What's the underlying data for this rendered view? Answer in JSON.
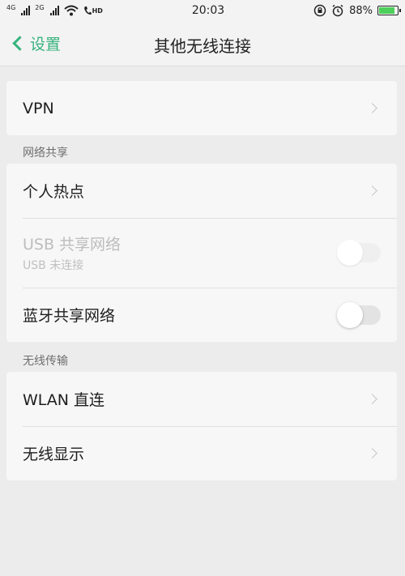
{
  "status_bar": {
    "net_left_1": "4G",
    "net_left_2": "2G",
    "hd": "HD",
    "time": "20:03",
    "battery_percent": "88%",
    "battery_level": 0.88,
    "battery_color": "#4ccf5b"
  },
  "nav": {
    "back_label": "设置",
    "title": "其他无线连接",
    "accent_color": "#36b37e"
  },
  "groups": {
    "vpn": {
      "label": "VPN"
    },
    "sharing": {
      "header": "网络共享",
      "hotspot": "个人热点",
      "usb": {
        "label": "USB 共享网络",
        "sub": "USB 未连接",
        "enabled": false,
        "on": false
      },
      "bluetooth": {
        "label": "蓝牙共享网络",
        "on": false
      }
    },
    "wireless": {
      "header": "无线传输",
      "wlan_direct": "WLAN 直连",
      "wireless_display": "无线显示"
    }
  },
  "icons": [
    "signal-icon",
    "wifi-icon",
    "call-hd-icon",
    "rotation-lock-icon",
    "alarm-icon",
    "battery-icon",
    "back-chevron-icon",
    "chevron-right-icon"
  ]
}
